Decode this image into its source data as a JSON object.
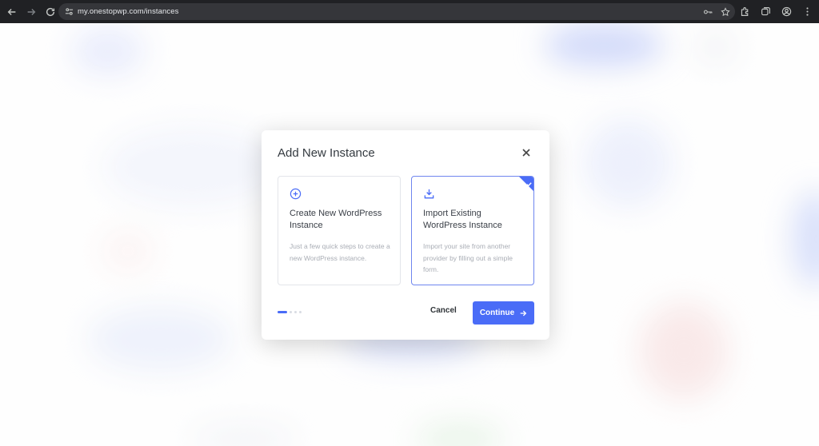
{
  "browser": {
    "url": "my.onestopwp.com/instances",
    "icons": [
      "back-icon",
      "forward-icon",
      "reload-icon",
      "site-info-icon",
      "password-key-icon",
      "bookmark-star-icon",
      "extensions-icon",
      "tab-search-icon",
      "profile-icon",
      "menu-icon"
    ]
  },
  "modal": {
    "title": "Add New Instance",
    "options": [
      {
        "icon": "plus-circle-icon",
        "title": "Create New WordPress Instance",
        "description": "Just a few quick steps to create a new WordPress instance.",
        "selected": false
      },
      {
        "icon": "download-icon",
        "title": "Import Existing WordPress Instance",
        "description": "Import your site from another provider by filling out a simple form.",
        "selected": true
      }
    ],
    "steps": {
      "current": 1,
      "total": 4
    },
    "cancel_label": "Cancel",
    "continue_label": "Continue"
  },
  "colors": {
    "accent": "#4a6cf7",
    "chrome_bg": "#202124",
    "omnibox_bg": "#35363a"
  }
}
